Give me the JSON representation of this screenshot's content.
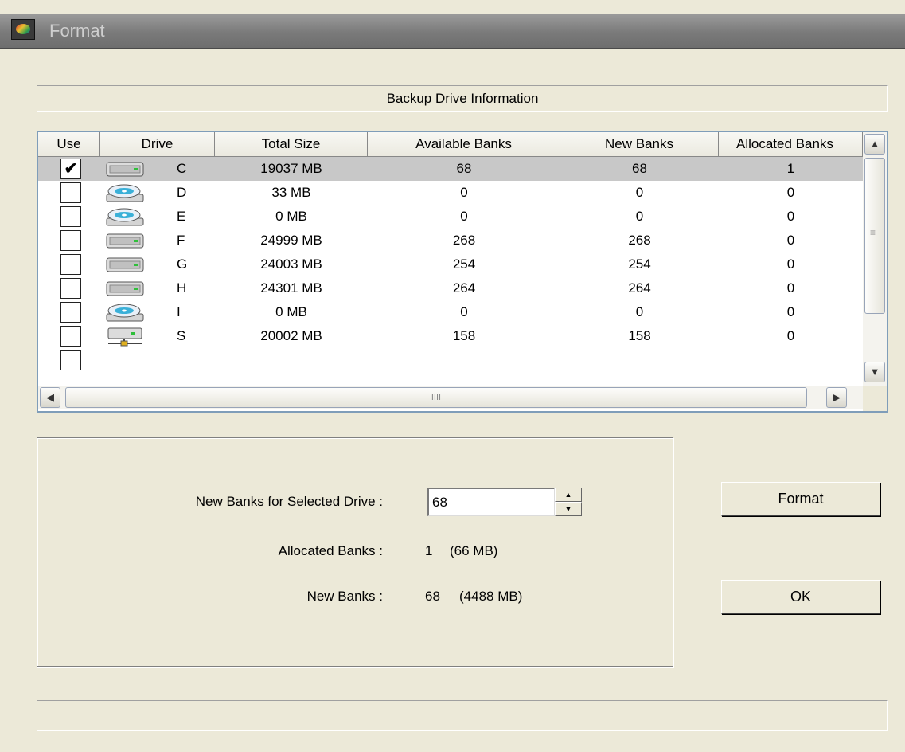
{
  "window": {
    "title": "Format"
  },
  "info_bar": {
    "label": "Backup Drive Information"
  },
  "table": {
    "columns": [
      "Use",
      "Drive",
      "Total Size",
      "Available Banks",
      "New Banks",
      "Allocated Banks"
    ],
    "rows": [
      {
        "use": true,
        "icon": "hard-drive-icon",
        "drive": "C",
        "total": "19037 MB",
        "available": "68",
        "new": "68",
        "allocated": "1"
      },
      {
        "use": false,
        "icon": "optical-drive-icon",
        "drive": "D",
        "total": "33 MB",
        "available": "0",
        "new": "0",
        "allocated": "0"
      },
      {
        "use": false,
        "icon": "optical-drive-icon",
        "drive": "E",
        "total": "0 MB",
        "available": "0",
        "new": "0",
        "allocated": "0"
      },
      {
        "use": false,
        "icon": "hard-drive-icon",
        "drive": "F",
        "total": "24999 MB",
        "available": "268",
        "new": "268",
        "allocated": "0"
      },
      {
        "use": false,
        "icon": "hard-drive-icon",
        "drive": "G",
        "total": "24003 MB",
        "available": "254",
        "new": "254",
        "allocated": "0"
      },
      {
        "use": false,
        "icon": "hard-drive-icon",
        "drive": "H",
        "total": "24301 MB",
        "available": "264",
        "new": "264",
        "allocated": "0"
      },
      {
        "use": false,
        "icon": "optical-drive-icon",
        "drive": "I",
        "total": "0 MB",
        "available": "0",
        "new": "0",
        "allocated": "0"
      },
      {
        "use": false,
        "icon": "network-drive-icon",
        "drive": "S",
        "total": "20002 MB",
        "available": "158",
        "new": "158",
        "allocated": "0"
      }
    ],
    "selected_row": 0
  },
  "settings": {
    "new_banks_label": "New Banks for Selected Drive :",
    "new_banks_value": "68",
    "allocated_label": "Allocated Banks :",
    "allocated_count": "1",
    "allocated_size": "(66 MB)",
    "new_label": "New Banks :",
    "new_count": "68",
    "new_size": "(4488 MB)"
  },
  "buttons": {
    "format": "Format",
    "ok": "OK"
  },
  "status_bar": {
    "text": ""
  }
}
